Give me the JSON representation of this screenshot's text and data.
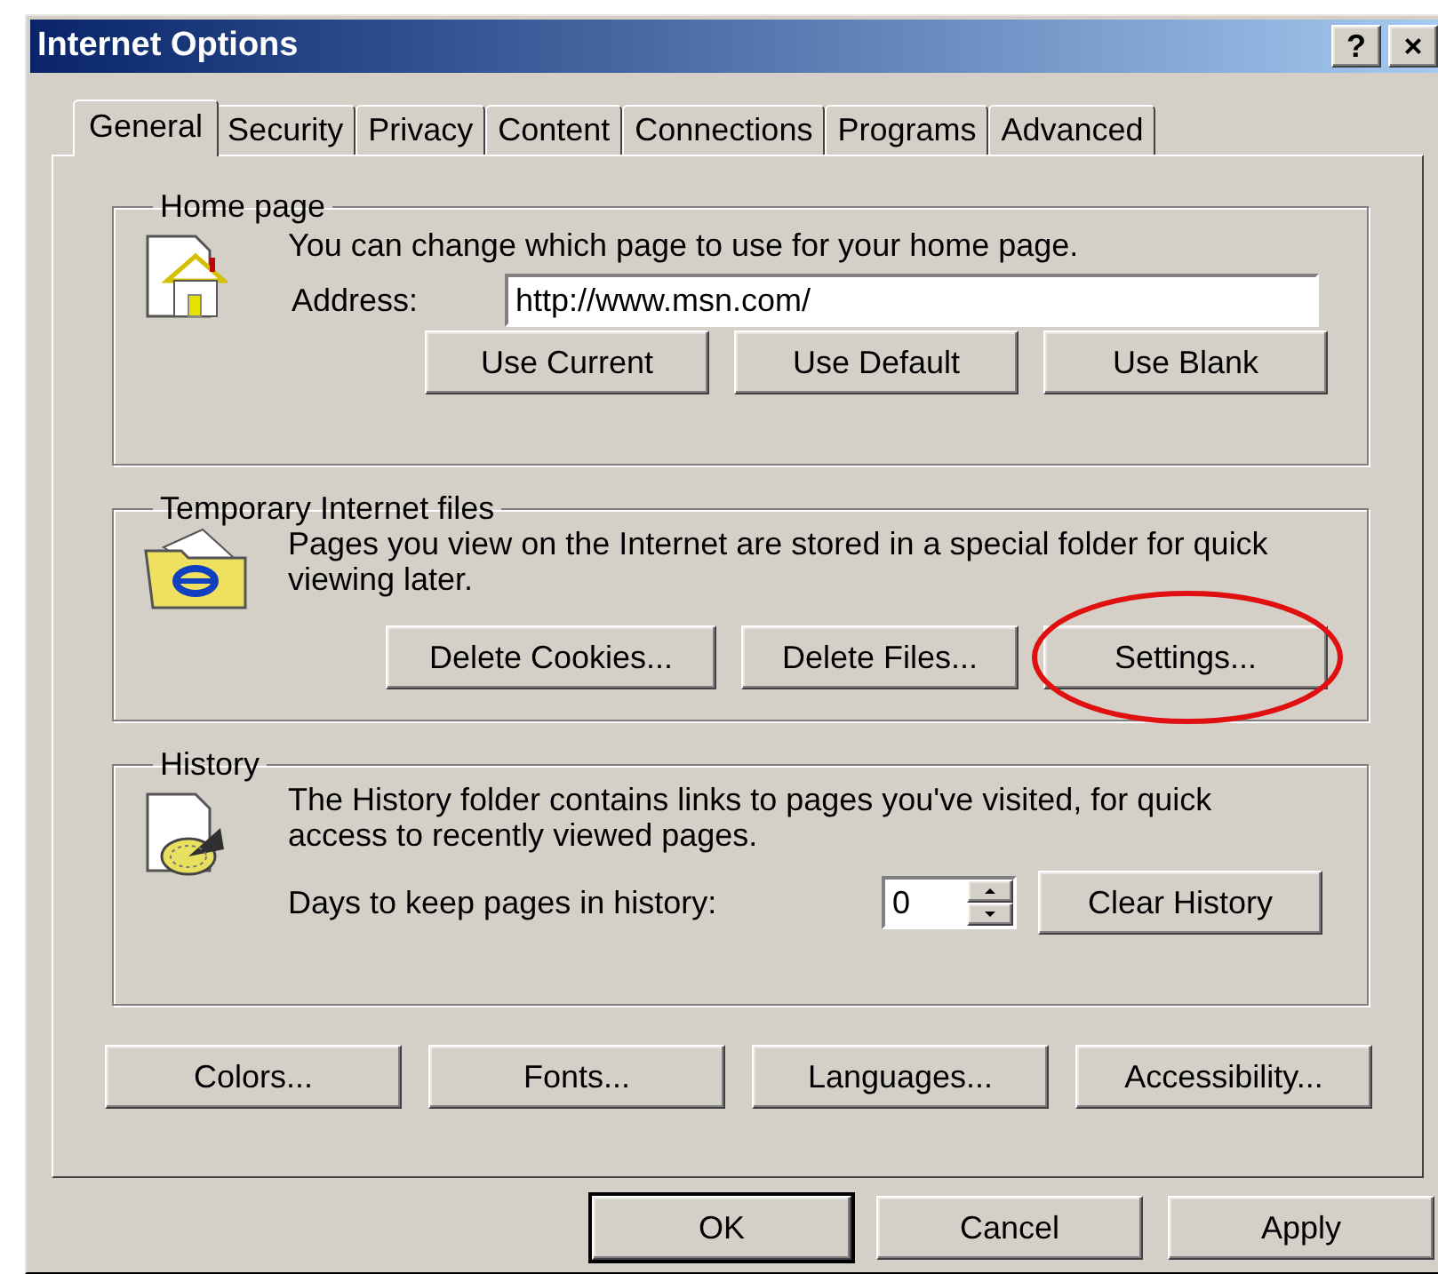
{
  "window": {
    "title": "Internet Options",
    "title_buttons": [
      "?",
      "×"
    ]
  },
  "tabs": [
    {
      "label": "General",
      "selected": true
    },
    {
      "label": "Security",
      "selected": false
    },
    {
      "label": "Privacy",
      "selected": false
    },
    {
      "label": "Content",
      "selected": false
    },
    {
      "label": "Connections",
      "selected": false
    },
    {
      "label": "Programs",
      "selected": false
    },
    {
      "label": "Advanced",
      "selected": false
    }
  ],
  "home_page": {
    "title": "Home page",
    "description": "You can change which page to use for your home page.",
    "address_label": "Address:",
    "address_value": "http://www.msn.com/",
    "buttons": [
      {
        "label": "Use Current",
        "circled": false
      },
      {
        "label": "Use Default",
        "circled": false
      },
      {
        "label": "Use Blank",
        "circled": false
      }
    ]
  },
  "temporary_files": {
    "title": "Temporary Internet files",
    "description": "Pages you view on the Internet are stored in a special folder for quick viewing later.",
    "buttons": [
      {
        "label": "Delete Cookies...",
        "circled": false
      },
      {
        "label": "Delete Files...",
        "circled": false
      },
      {
        "label": "Settings...",
        "circled": true
      }
    ]
  },
  "history": {
    "title": "History",
    "description": "The History folder contains links to pages you've visited, for quick access to recently viewed pages.",
    "days_label": "Days to keep pages in history:",
    "days_value": "0",
    "button": {
      "label": "Clear History",
      "circled": false
    }
  },
  "bottom_buttons": [
    {
      "label": "Colors..."
    },
    {
      "label": "Fonts..."
    },
    {
      "label": "Languages..."
    },
    {
      "label": "Accessibility..."
    }
  ],
  "dialog_buttons": [
    {
      "label": "OK",
      "default": true
    },
    {
      "label": "Cancel",
      "default": false
    },
    {
      "label": "Apply",
      "default": false
    }
  ]
}
